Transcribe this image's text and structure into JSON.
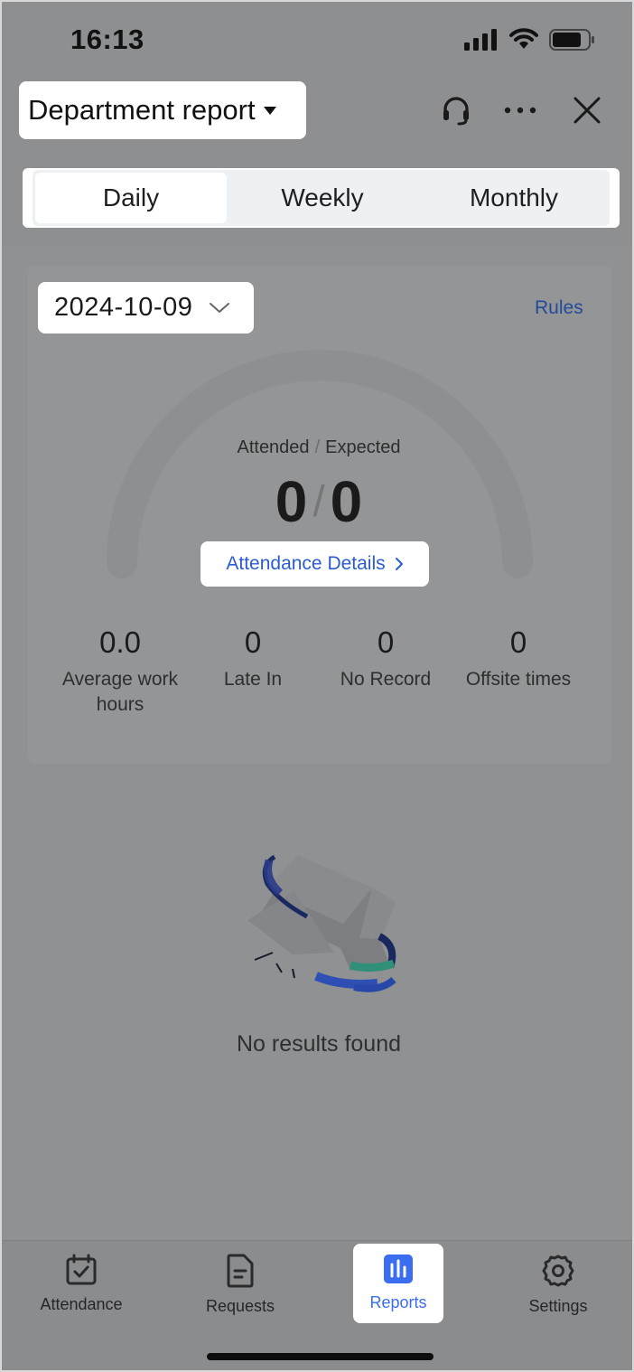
{
  "status_bar": {
    "time": "16:13"
  },
  "header": {
    "title": "Department report",
    "icons": [
      "support-icon",
      "more-icon",
      "close-icon"
    ]
  },
  "tabs": [
    {
      "label": "Daily",
      "active": true
    },
    {
      "label": "Weekly",
      "active": false
    },
    {
      "label": "Monthly",
      "active": false
    }
  ],
  "report": {
    "date": "2024-10-09",
    "rules_link": "Rules",
    "ratio": {
      "attended_label": "Attended",
      "separator": "/",
      "expected_label": "Expected",
      "attended_value": "0",
      "expected_value": "0"
    },
    "details_button": "Attendance Details",
    "metrics": [
      {
        "value": "0.0",
        "label": "Average work hours"
      },
      {
        "value": "0",
        "label": "Late In"
      },
      {
        "value": "0",
        "label": "No Record"
      },
      {
        "value": "0",
        "label": "Offsite times"
      }
    ]
  },
  "empty_state": {
    "text": "No results found",
    "icon": "empty-box-icon"
  },
  "bottom_nav": [
    {
      "label": "Attendance",
      "icon": "calendar-check-icon",
      "active": false
    },
    {
      "label": "Requests",
      "icon": "document-icon",
      "active": false
    },
    {
      "label": "Reports",
      "icon": "bar-chart-icon",
      "active": true
    },
    {
      "label": "Settings",
      "icon": "gear-icon",
      "active": false
    }
  ],
  "colors": {
    "accent": "#3b6df0",
    "link": "#2a5bd7",
    "overlay": "#8e8f91"
  }
}
